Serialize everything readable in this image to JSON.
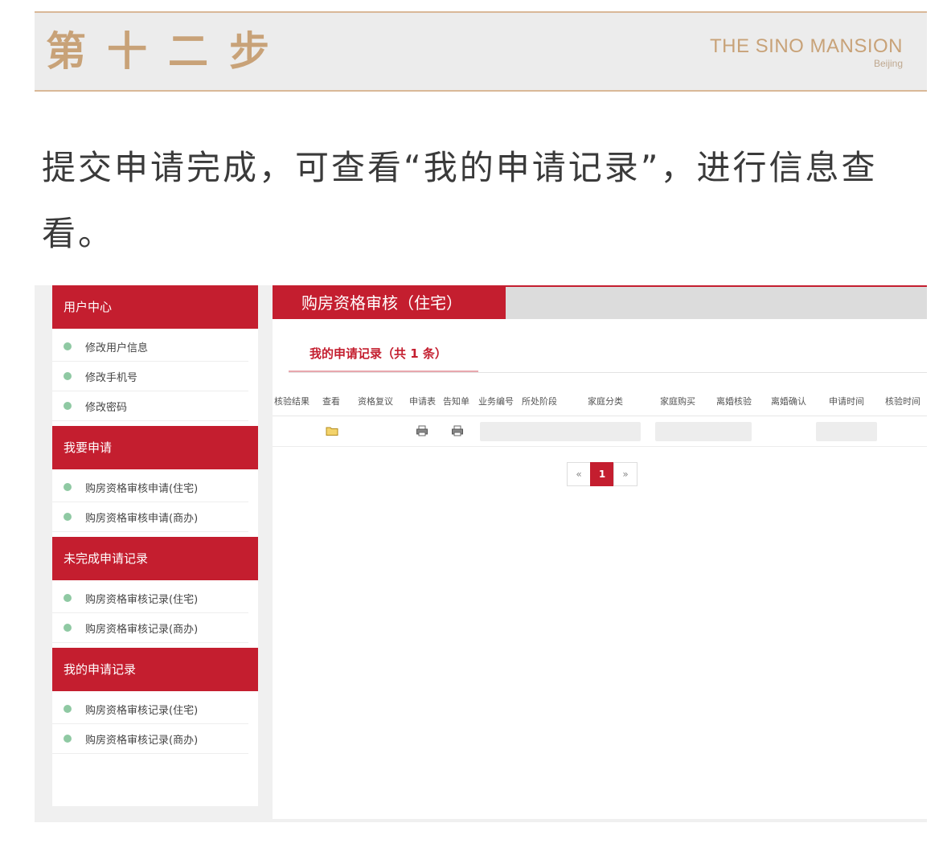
{
  "header": {
    "step_title": "第十二步",
    "brand_name": "THE SINO MANSION",
    "brand_city": "Beijing"
  },
  "instruction": "提交申请完成，可查看“我的申请记录”，进行信息查看。",
  "sidebar": {
    "sections": [
      {
        "title": "用户中心",
        "items": [
          "修改用户信息",
          "修改手机号",
          "修改密码"
        ]
      },
      {
        "title": "我要申请",
        "items": [
          "购房资格审核申请(住宅)",
          "购房资格审核申请(商办)"
        ]
      },
      {
        "title": "未完成申请记录",
        "items": [
          "购房资格审核记录(住宅)",
          "购房资格审核记录(商办)"
        ]
      },
      {
        "title": "我的申请记录",
        "items": [
          "购房资格审核记录(住宅)",
          "购房资格审核记录(商办)"
        ]
      }
    ]
  },
  "main": {
    "title": "购房资格审核（住宅）",
    "tab": "我的申请记录（共 1 条）",
    "columns": [
      "核验结果",
      "查看",
      "资格复议",
      "申请表",
      "告知单",
      "业务编号",
      "所处阶段",
      "家庭分类",
      "家庭购买",
      "离婚核验",
      "离婚确认",
      "申请时间",
      "核验时间"
    ],
    "row_icons": {
      "view": "folder-icon",
      "form": "printer-icon",
      "notice": "printer-icon"
    },
    "pagination": {
      "prev": "«",
      "current": "1",
      "next": "»"
    }
  },
  "colors": {
    "accent_red": "#c41e2f",
    "gold": "#c8a278",
    "dot_green": "#8fc9a3"
  }
}
